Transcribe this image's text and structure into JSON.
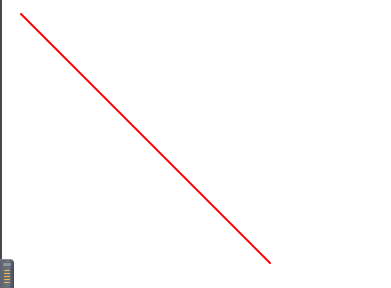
{
  "canvas": {
    "background_color": "#ffffff",
    "line_color": "#ff0000",
    "edge_color": "#4a4a4a"
  },
  "handle": {
    "icon": "grip-handle-icon",
    "accent_color": "#e8b94a"
  }
}
